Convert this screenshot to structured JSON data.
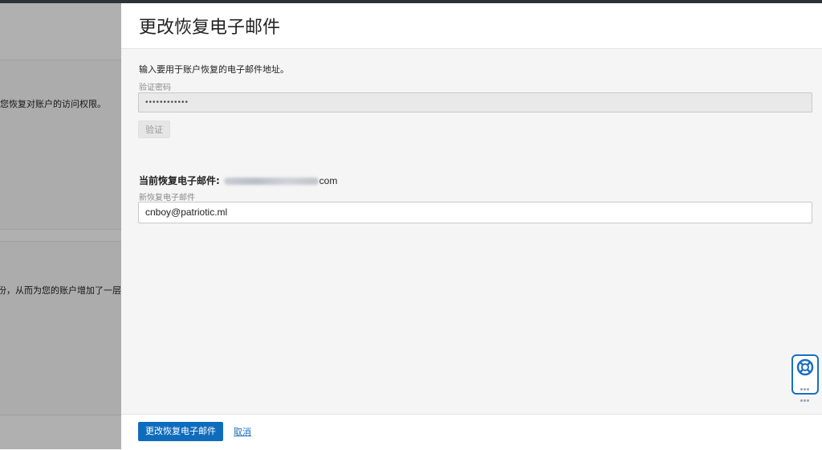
{
  "background_page": {
    "line1": "您恢复对账户的访问权限。",
    "line2": "份，从而为您的账户增加了一层"
  },
  "dialog": {
    "title": "更改恢复电子邮件",
    "instruction": "输入要用于账户恢复的电子邮件地址。",
    "verify_password": {
      "label": "验证密码",
      "value": "••••••••••••"
    },
    "verify_button": "验证",
    "current_email": {
      "label": "当前恢复电子邮件:",
      "suffix": "com"
    },
    "new_email": {
      "label": "新恢复电子邮件",
      "value": "cnboy@patriotic.ml"
    },
    "footer": {
      "submit_label": "更改恢复电子邮件",
      "cancel_label": "取消"
    }
  },
  "help_widget": {
    "icon": "lifebuoy-icon"
  },
  "colors": {
    "accent": "#0f6cbd",
    "link": "#1a6fc0"
  }
}
